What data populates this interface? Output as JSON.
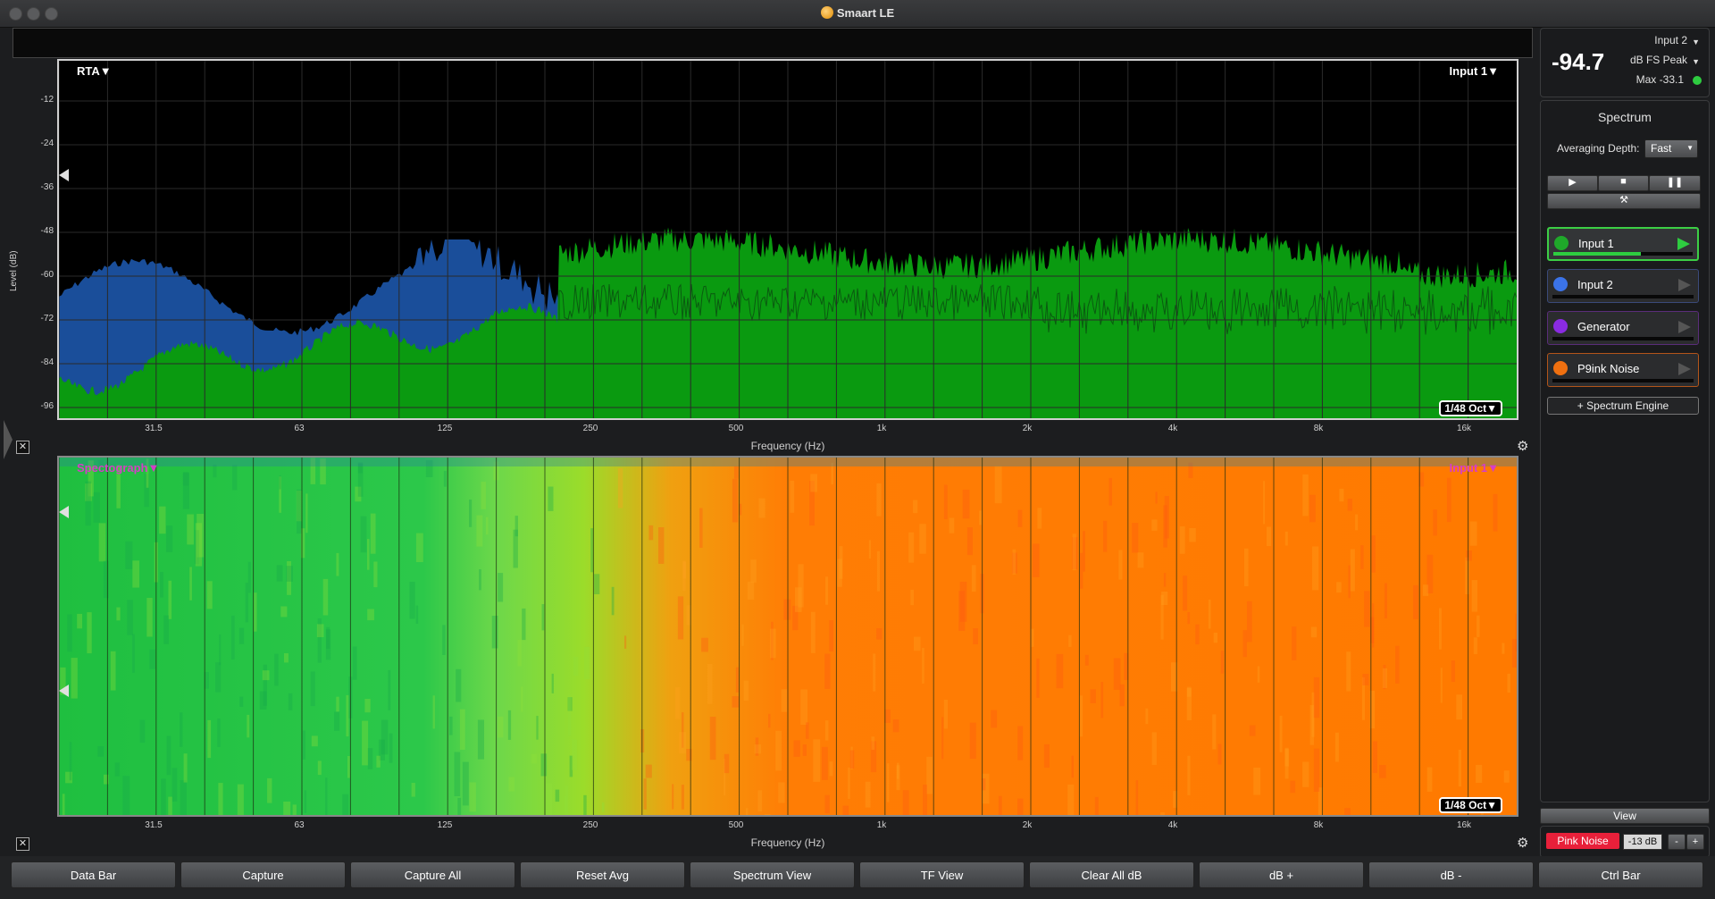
{
  "app": {
    "title": "Smaart LE"
  },
  "rta": {
    "mode_label": "RTA▼",
    "input_label": "Input 1▼",
    "resolution": "1/48 Oct▼",
    "y_axis_label": "Level (dB)",
    "x_axis_label": "Frequency (Hz)",
    "y_ticks": [
      "-12",
      "-24",
      "-36",
      "-48",
      "-60",
      "-72",
      "-84",
      "-96"
    ],
    "x_ticks": [
      "31.5",
      "63",
      "125",
      "250",
      "500",
      "1k",
      "2k",
      "4k",
      "8k",
      "16k"
    ]
  },
  "spectrograph": {
    "mode_label": "Spectograph▼",
    "input_label": "Input 1▼",
    "resolution": "1/48 Oct▼",
    "x_axis_label": "Frequency (Hz)",
    "x_ticks": [
      "31.5",
      "63",
      "125",
      "250",
      "500",
      "1k",
      "2k",
      "4k",
      "8k",
      "16k"
    ]
  },
  "meter": {
    "value": "-94.7",
    "input": "Input 2",
    "unit": "dB FS Peak",
    "max": "Max -33.1",
    "status_color": "#2ecc40"
  },
  "spectrum_panel": {
    "title": "Spectrum",
    "averaging_label": "Averaging Depth:",
    "averaging_value": "Fast",
    "play_icon": "play-icon",
    "stop_icon": "stop-icon",
    "pause_icon": "pause-icon",
    "tools_icon": "tools-icon",
    "inputs": [
      {
        "name": "Input 1",
        "color": "#1fa82a",
        "border": "#3ccf45",
        "arrow": "#2ecc40",
        "meter": 0.63
      },
      {
        "name": "Input 2",
        "color": "#3b73e8",
        "border": "#3b4a7a",
        "arrow": "#555",
        "meter": 0.0
      },
      {
        "name": "Generator",
        "color": "#8a2be2",
        "border": "#5a2d7a",
        "arrow": "#555",
        "meter": 0.0
      },
      {
        "name": "P9ink Noise",
        "color": "#f07010",
        "border": "#b3551a",
        "arrow": "#555",
        "meter": 0.0
      }
    ],
    "add_engine": "+ Spectrum Engine"
  },
  "view_panel": {
    "view_label": "View",
    "pink_noise": "Pink Noise",
    "noise_level": "-13 dB",
    "minus": "-",
    "plus": "+"
  },
  "bottom_bar": [
    "Data Bar",
    "Capture",
    "Capture All",
    "Reset Avg",
    "Spectrum View",
    "TF View",
    "Clear All dB",
    "dB +",
    "dB -",
    "Ctrl Bar"
  ],
  "colors": {
    "rta_green": "#0a9a10",
    "rta_blue": "#1a4e9a",
    "spectro_orange": "#ff7a00",
    "spectro_green": "#22c43a"
  }
}
